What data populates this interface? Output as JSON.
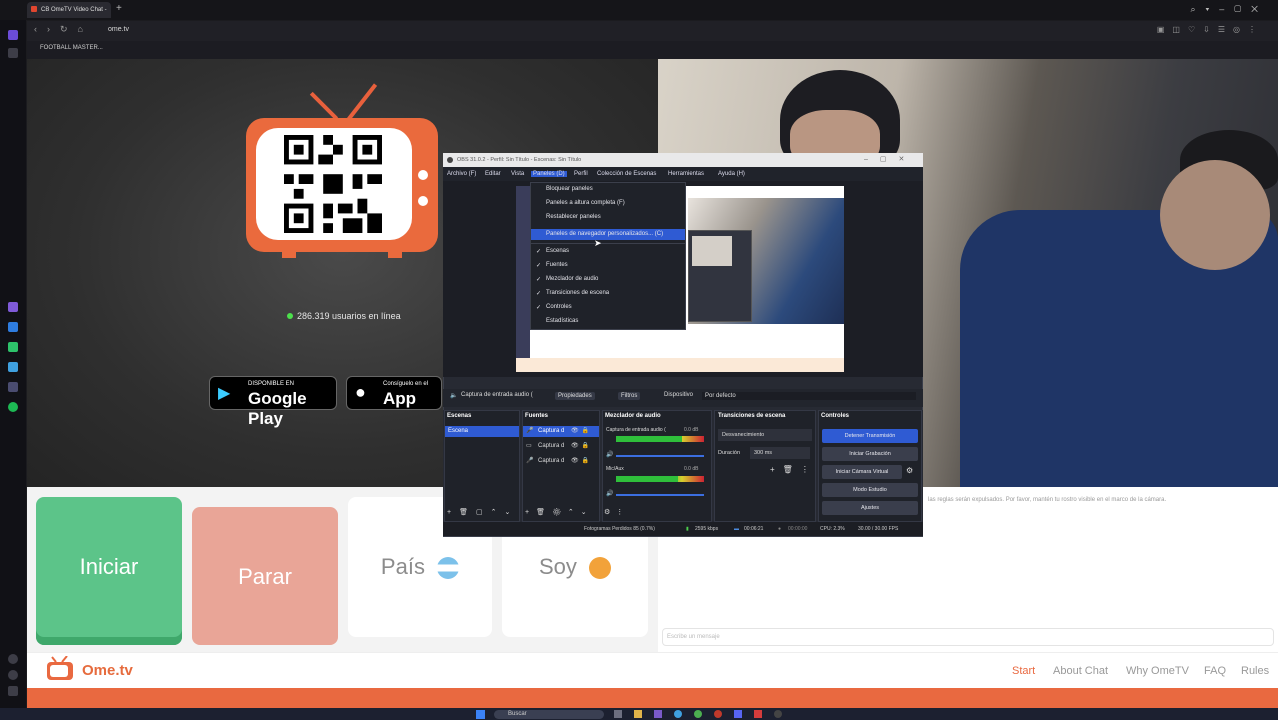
{
  "browser": {
    "tab_title": "CB OmeTV Video Chat -",
    "url": "ome.tv",
    "bookmark": "FOOTBALL MASTER..."
  },
  "page": {
    "online_count": "286.319 usuarios en línea",
    "google_play": {
      "small": "DISPONIBLE EN",
      "big": "Google Play"
    },
    "app_store": {
      "small": "Consíguelo en el",
      "big": "App Store"
    },
    "buttons": {
      "start": "Iniciar",
      "stop": "Parar",
      "country": "País",
      "gender": "Soy"
    },
    "chat_rules": "las reglas serán expulsados. Por favor, mantén tu rostro visible en el marco de la cámara.",
    "chat_placeholder": "Escribe un mensaje",
    "footer": {
      "brand": "Ome.tv",
      "links": [
        "Start",
        "About Chat",
        "Why OmeTV",
        "FAQ",
        "Rules"
      ]
    }
  },
  "obs": {
    "title": "OBS 31.0.2 - Perfil: Sin Título - Escenas: Sin Título",
    "menu": [
      "Archivo (F)",
      "Editar",
      "Vista",
      "Paneles (D)",
      "Perfil",
      "Colección de Escenas",
      "Herramientas",
      "Ayuda (H)"
    ],
    "dropdown": {
      "items": [
        "Bloquear paneles",
        "Paneles a altura completa (F)",
        "Restablecer paneles",
        "Paneles de navegador personalizados... (C)"
      ],
      "checked": [
        "Escenas",
        "Fuentes",
        "Mezclador de audio",
        "Transiciones de escena",
        "Controles"
      ],
      "last": "Estadísticas"
    },
    "source_bar": {
      "source": "Captura de entrada audio (",
      "properties": "Propiedades",
      "filters": "Filtros",
      "device_label": "Dispositivo",
      "device_value": "Por defecto"
    },
    "docks": {
      "scenes": {
        "title": "Escenas",
        "item": "Escena"
      },
      "sources": {
        "title": "Fuentes",
        "items": [
          "Captura d",
          "Captura d",
          "Captura d"
        ]
      },
      "mixer": {
        "title": "Mezclador de audio",
        "ch1": "Captura de entrada audio (",
        "ch1_db": "0.0 dB",
        "ch2": "Mic/Aux",
        "ch2_db": "0.0 dB",
        "ch1_level": 0.75,
        "ch2_level": 0.7
      },
      "transitions": {
        "title": "Transiciones de escena",
        "type": "Desvanecimiento",
        "duration_label": "Duración",
        "duration": "300 ms"
      },
      "controls": {
        "title": "Controles",
        "buttons": [
          "Detener Transmisión",
          "Iniciar Grabación",
          "Iniciar Cámara Virtual",
          "Modo Estudio",
          "Ajustes"
        ]
      }
    },
    "status": {
      "dropped": "Fotogramas Perdidos 85 (0.7%)",
      "kbps": "2595 kbps",
      "stream_time": "00:06:21",
      "rec_time": "00:00:00",
      "cpu": "CPU: 2.3%",
      "fps": "30.00 / 30.00 FPS"
    }
  },
  "taskbar": {
    "search": "Buscar"
  },
  "colors": {
    "accent": "#e96940",
    "start": "#5cc489",
    "stop": "#e9a597",
    "obs_highlight": "#2f5bd3"
  }
}
